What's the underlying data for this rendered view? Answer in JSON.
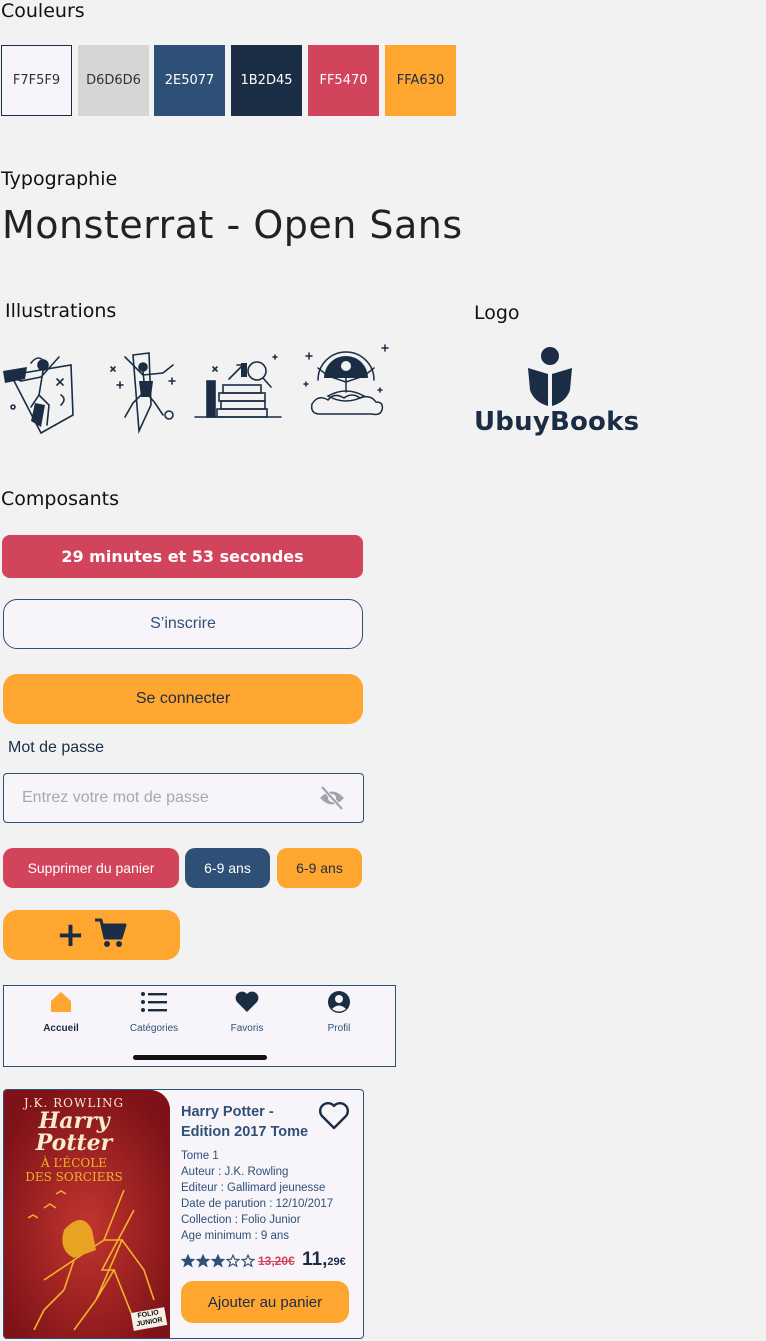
{
  "colors_section": {
    "title": "Couleurs",
    "swatches": [
      {
        "label": "F7F5F9",
        "color": "#F7F5F9"
      },
      {
        "label": "D6D6D6",
        "color": "#D6D6D6"
      },
      {
        "label": "2E5077",
        "color": "#2E5077"
      },
      {
        "label": "1B2D45",
        "color": "#1B2D45"
      },
      {
        "label": "FF5470",
        "color": "#D2435C"
      },
      {
        "label": "FFA630",
        "color": "#FFA630"
      }
    ]
  },
  "typography": {
    "title": "Typographie",
    "sample": "Monsterrat - Open Sans"
  },
  "illustrations": {
    "title": "Illustrations"
  },
  "logo": {
    "title": "Logo",
    "brand": "UbuyBooks"
  },
  "components": {
    "title": "Composants",
    "timer": "29 minutes et 53 secondes",
    "signup_label": "S’inscrire",
    "login_label": "Se connecter",
    "password_label": "Mot de passe",
    "password_placeholder": "Entrez votre mot de passe",
    "remove_label": "Supprimer du panier",
    "age_tag_blue": "6-9 ans",
    "age_tag_orange": "6-9 ans",
    "add_cart_plus": "+"
  },
  "bottom_nav": {
    "items": [
      {
        "label": "Accueil",
        "icon": "home-icon",
        "active": true
      },
      {
        "label": "Catégories",
        "icon": "list-icon",
        "active": false
      },
      {
        "label": "Favoris",
        "icon": "heart-icon",
        "active": false
      },
      {
        "label": "Profil",
        "icon": "user-icon",
        "active": false
      }
    ]
  },
  "book_card": {
    "cover_author": "J.K. ROWLING",
    "cover_title_1": "Harry",
    "cover_title_2": "Potter",
    "cover_subtitle_1": "À L’ÉCOLE",
    "cover_subtitle_2": "DES SORCIERS",
    "cover_badge": "FOLIO JUNIOR",
    "title_line1": "Harry Potter -",
    "title_line2": "Edition 2017 Tome",
    "tome": "Tome 1",
    "author": "Auteur : J.K. Rowling",
    "publisher": "Editeur : Gallimard jeunesse",
    "date": "Date de parution : 12/10/2017",
    "collection": "Collection : Folio Junior",
    "age": "Age minimum : 9 ans",
    "rating": 3,
    "rating_max": 5,
    "old_price": "13,20€",
    "price_main": "11,",
    "price_cents": "29€",
    "add_label": "Ajouter au panier"
  }
}
